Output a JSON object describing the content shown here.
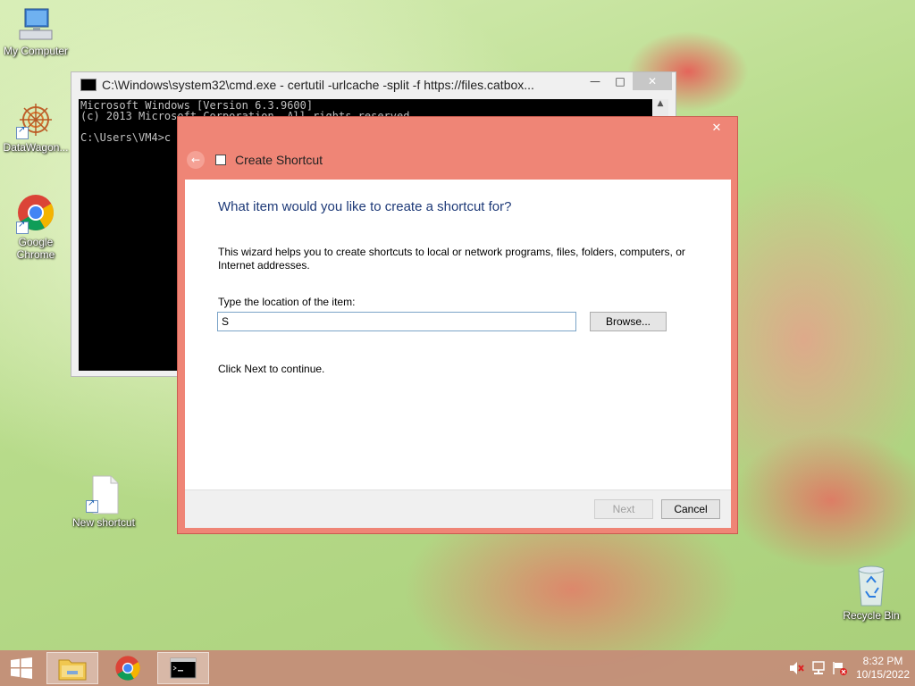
{
  "desktop": {
    "icons": [
      {
        "label": "My Computer"
      },
      {
        "label": "DataWagon..."
      },
      {
        "label": "Google Chrome"
      },
      {
        "label": "New shortcut"
      },
      {
        "label": "Recycle Bin"
      }
    ]
  },
  "cmd_window": {
    "title": "C:\\Windows\\system32\\cmd.exe - certutil  -urlcache -split -f https://files.catbox...",
    "lines": [
      "Microsoft Windows [Version 6.3.9600]",
      "(c) 2013 Microsoft Corporation. All rights reserved.",
      "",
      "C:\\Users\\VM4>c"
    ]
  },
  "dialog": {
    "title": "Create Shortcut",
    "heading": "What item would you like to create a shortcut for?",
    "description": "This wizard helps you to create shortcuts to local or network programs, files, folders, computers, or Internet addresses.",
    "location_label": "Type the location of the item:",
    "location_value": "S",
    "browse_label": "Browse...",
    "continue_text": "Click Next to continue.",
    "next_label": "Next",
    "cancel_label": "Cancel"
  },
  "taskbar": {
    "time": "8:32 PM",
    "date": "10/15/2022"
  }
}
